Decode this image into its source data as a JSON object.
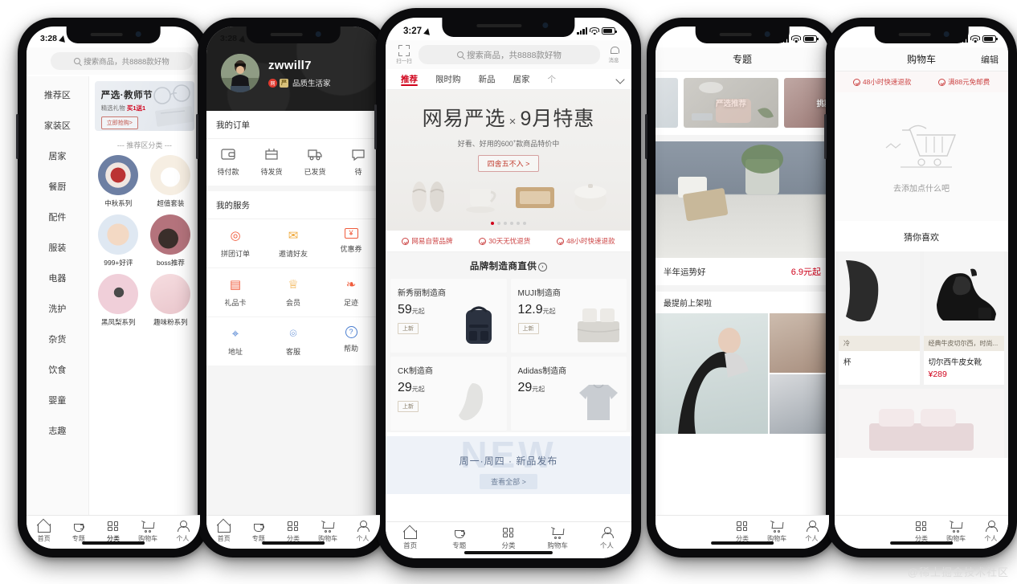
{
  "watermark": "@稀土掘金技术社区",
  "phones": {
    "category": {
      "status": {
        "time": "3:28"
      },
      "search": {
        "placeholder": "搜索商品，共8888款好物"
      },
      "sidebar": [
        {
          "label": "推荐区"
        },
        {
          "label": "家装区"
        },
        {
          "label": "居家"
        },
        {
          "label": "餐厨"
        },
        {
          "label": "配件"
        },
        {
          "label": "服装"
        },
        {
          "label": "电器"
        },
        {
          "label": "洗护"
        },
        {
          "label": "杂货"
        },
        {
          "label": "饮食"
        },
        {
          "label": "婴童"
        },
        {
          "label": "志趣"
        }
      ],
      "banner": {
        "title": "严选·教师节",
        "subtitle": "精选礼物",
        "highlight": "买1送1",
        "button": "立即抢购>"
      },
      "divider": "--- 推荐区分类 ---",
      "items": [
        {
          "label": "中秋系列"
        },
        {
          "label": "超值套装"
        },
        {
          "label": "999+好评"
        },
        {
          "label": "boss推荐"
        },
        {
          "label": "黑凤梨系列"
        },
        {
          "label": "趣味粉系列"
        }
      ],
      "tabbar": [
        {
          "label": "首页",
          "icon": "home-icon"
        },
        {
          "label": "专题",
          "icon": "cup-icon"
        },
        {
          "label": "分类",
          "icon": "grid-icon"
        },
        {
          "label": "购物车",
          "icon": "cart-icon"
        },
        {
          "label": "个人",
          "icon": "user-icon"
        }
      ]
    },
    "profile": {
      "status": {
        "time": "3:28"
      },
      "user": {
        "name": "zwwill7",
        "badge_text": "品质生活家",
        "badge_red": "网",
        "badge_gold": "严"
      },
      "orders": {
        "title": "我的订单",
        "items": [
          {
            "label": "待付款",
            "icon": "wallet-icon"
          },
          {
            "label": "待发货",
            "icon": "package-icon"
          },
          {
            "label": "已发货",
            "icon": "truck-icon"
          },
          {
            "label": "待",
            "icon": "review-icon"
          }
        ]
      },
      "services": {
        "title": "我的服务",
        "items": [
          {
            "label": "拼团订单",
            "icon": "group-buy-icon",
            "glyph": "◎",
            "color": "#f05c3c"
          },
          {
            "label": "邀请好友",
            "icon": "envelope-icon",
            "glyph": "✉",
            "color": "#f0a93c"
          },
          {
            "label": "优惠券",
            "icon": "coupon-icon",
            "glyph": "¥",
            "color": "#f05c3c"
          },
          {
            "label": "礼品卡",
            "icon": "gift-card-icon",
            "glyph": "▤",
            "color": "#f05c3c"
          },
          {
            "label": "会员",
            "icon": "crown-icon",
            "glyph": "♕",
            "color": "#f0a93c"
          },
          {
            "label": "足迹",
            "icon": "footprint-icon",
            "glyph": "❧",
            "color": "#f05c3c"
          },
          {
            "label": "地址",
            "icon": "location-pin-icon",
            "glyph": "⌖",
            "color": "#4a7ed0"
          },
          {
            "label": "客服",
            "icon": "headset-icon",
            "glyph": "⌾",
            "color": "#4a7ed0"
          },
          {
            "label": "帮助",
            "icon": "question-circle-icon",
            "glyph": "?",
            "color": "#4a7ed0"
          }
        ]
      },
      "tabbar": [
        {
          "label": "首页",
          "icon": "home-icon"
        },
        {
          "label": "专题",
          "icon": "cup-icon"
        },
        {
          "label": "分类",
          "icon": "grid-icon"
        },
        {
          "label": "购物车",
          "icon": "cart-icon"
        },
        {
          "label": "个人",
          "icon": "user-icon"
        }
      ]
    },
    "home": {
      "status": {
        "time": "3:27"
      },
      "scan_label": "扫一扫",
      "message_label": "消息",
      "search": {
        "placeholder": "搜索商品，共8888款好物"
      },
      "tabs": [
        {
          "label": "推荐",
          "active": true
        },
        {
          "label": "限时购",
          "active": false
        },
        {
          "label": "新品",
          "active": false
        },
        {
          "label": "居家",
          "active": false
        },
        {
          "label": "个",
          "active": false
        }
      ],
      "promo": {
        "title_left": "网易严选",
        "title_x": "×",
        "title_right": "9月特惠",
        "subtitle": "好看、好用的600",
        "subtitle_sup": "+",
        "subtitle_tail": "款商品特价中",
        "cta": "四舍五不入 >"
      },
      "features": [
        {
          "label": "网易自营品牌"
        },
        {
          "label": "30天无忧退货"
        },
        {
          "label": "48小时快速退款"
        }
      ],
      "brand": {
        "title": "品牌制造商直供",
        "cards": [
          {
            "name": "新秀丽制造商",
            "price": "59",
            "unit": "元起",
            "tag": "上新",
            "img": "backpack"
          },
          {
            "name": "MUJI制造商",
            "price": "12.9",
            "unit": "元起",
            "tag": "上新",
            "img": "bedding"
          },
          {
            "name": "CK制造商",
            "price": "29",
            "unit": "元起",
            "tag": "上新",
            "img": "sock"
          },
          {
            "name": "Adidas制造商",
            "price": "29",
            "unit": "元起",
            "tag": "",
            "img": "shirt"
          }
        ]
      },
      "newpub": {
        "ghost": "NEW",
        "title": "周一·周四 · 新品发布",
        "button": "查看全部 >"
      },
      "tabbar": [
        {
          "label": "首页",
          "icon": "home-icon"
        },
        {
          "label": "专题",
          "icon": "cup-icon"
        },
        {
          "label": "分类",
          "icon": "grid-icon"
        },
        {
          "label": "购物车",
          "icon": "cart-icon"
        },
        {
          "label": "个人",
          "icon": "user-icon"
        }
      ]
    },
    "topics": {
      "title": "专题",
      "carousel": [
        {
          "caption": ""
        },
        {
          "caption": "严选推荐"
        },
        {
          "caption": "挑款"
        }
      ],
      "row": {
        "title": "半年运势好",
        "price": "6.9元起"
      },
      "row2": {
        "title": "最提前上架啦"
      },
      "tabbar": [
        {
          "label": "分类",
          "icon": "grid-icon"
        },
        {
          "label": "购物车",
          "icon": "cart-icon"
        },
        {
          "label": "个人",
          "icon": "user-icon"
        }
      ]
    },
    "cart": {
      "title": "购物车",
      "edit": "编辑",
      "features": [
        {
          "label": "48小时快速退款"
        },
        {
          "label": "满88元免邮费"
        }
      ],
      "empty_msg": "去添加点什么吧",
      "guess_title": "猜你喜欢",
      "products": [
        {
          "tag": "冷",
          "name": "杯",
          "price": "",
          "img": "boot-side"
        },
        {
          "tag": "经典牛皮切尔西，时尚...",
          "name": "切尔西牛皮女靴",
          "price": "¥289",
          "img": "chelsea-boot"
        },
        {
          "tag": "",
          "name": "",
          "price": "",
          "img": "bedding-pink"
        }
      ],
      "tabbar": [
        {
          "label": "分类",
          "icon": "grid-icon"
        },
        {
          "label": "购物车",
          "icon": "cart-icon"
        },
        {
          "label": "个人",
          "icon": "user-icon"
        }
      ]
    }
  }
}
